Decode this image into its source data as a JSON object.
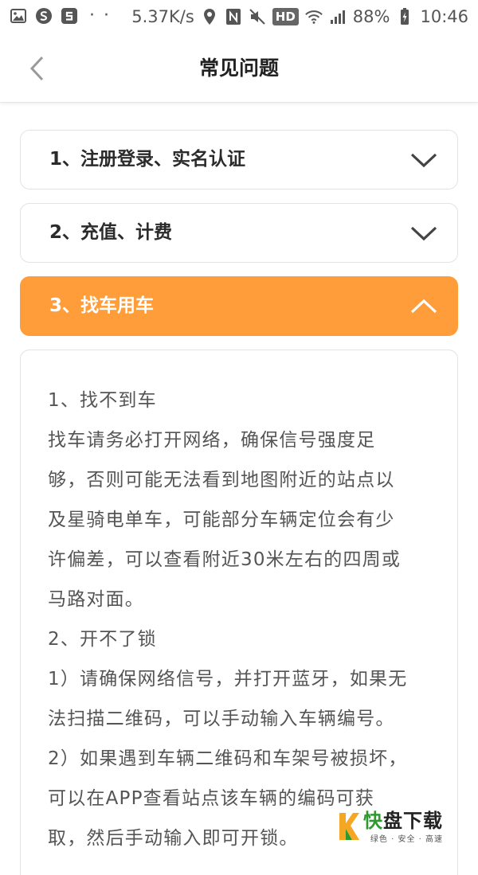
{
  "status_bar": {
    "net_speed": "5.37K/s",
    "hd_label": "HD",
    "battery": "88%",
    "time": "10:46",
    "dots": "· ·",
    "icons": [
      "gallery-icon",
      "s-app-icon",
      "s-app2-icon",
      "location-icon",
      "nfc-icon",
      "mute-icon",
      "wifi-icon",
      "signal-icon",
      "battery-icon"
    ]
  },
  "header": {
    "title": "常见问题",
    "back_icon": "chevron-left-icon"
  },
  "faq": {
    "items": [
      {
        "label": "1、注册登录、实名认证",
        "expanded": false
      },
      {
        "label": "2、充值、计费",
        "expanded": false
      },
      {
        "label": "3、找车用车",
        "expanded": true
      }
    ],
    "answer_lines": [
      "1、找不到车",
      "找车请务必打开网络，确保信号强度足",
      "够，否则可能无法看到地图附近的站点以",
      "及星骑电单车，可能部分车辆定位会有少",
      "许偏差，可以查看附近30米左右的四周或",
      "马路对面。",
      "2、开不了锁",
      "1）请确保网络信号，并打开蓝牙，如果无",
      "法扫描二维码，可以手动输入车辆编号。",
      "2）如果遇到车辆二维码和车架号被损坏，",
      "可以在APP查看站点该车辆的编码可获",
      "取，然后手动输入即可开锁。"
    ]
  },
  "watermark": {
    "first_char": "快",
    "rest": "盘下载",
    "sub": "绿色 · 安全 · 高速"
  },
  "colors": {
    "accent": "#ff9d3b",
    "text": "#555555",
    "border": "#e3e3e3"
  }
}
